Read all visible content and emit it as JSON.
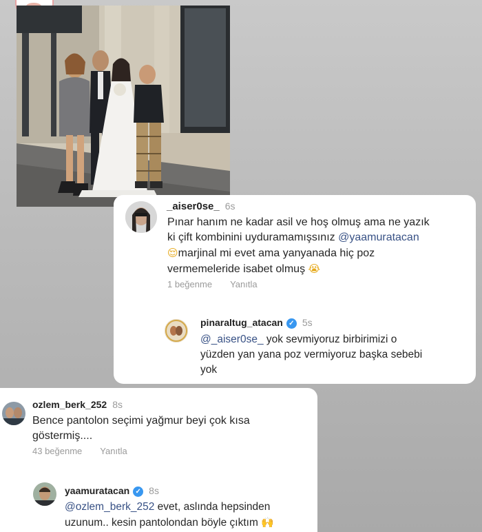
{
  "comments": [
    {
      "username": "_aiser0se_",
      "time": "6s",
      "text_lines": [
        "Pınar hanım ne kadar asil ve hoş olmuş ama ne yazık",
        "ki çift kombinini uyduramamışsınız",
        "marjinal mi evet ama yanyanada hiç poz",
        "vermemeleride isabet olmuş"
      ],
      "mention": "@yaamuratacan",
      "emoji_1": "😌",
      "emoji_2": "😭",
      "likes": "1 beğenme",
      "reply_label": "Yanıtla",
      "reply": {
        "username": "pinaraltug_atacan",
        "verified": true,
        "time": "5s",
        "mention": "@_aiser0se_",
        "text_lines": [
          "yok sevmiyoruz birbirimizi o",
          "yüzden yan yana poz vermiyoruz başka sebebi",
          "yok"
        ]
      }
    },
    {
      "username": "ozlem_berk_252",
      "time": "8s",
      "text_lines": [
        "Bence pantolon seçimi yağmur beyi çok kısa",
        "göstermiş...."
      ],
      "likes": "43 beğenme",
      "reply_label": "Yanıtla",
      "reply": {
        "username": "yaamuratacan",
        "verified": true,
        "time": "8s",
        "mention": "@ozlem_berk_252",
        "text_lines": [
          "evet, aslında hepsinden",
          "uzunum.. kesin pantolondan böyle çıktım"
        ],
        "emoji": "🙌"
      }
    }
  ],
  "icons": {
    "verified": "verified-badge-icon",
    "photo": "wedding-photo"
  },
  "colors": {
    "mention": "#385185",
    "verified": "#3897f0",
    "meta": "#9a9a9a"
  }
}
